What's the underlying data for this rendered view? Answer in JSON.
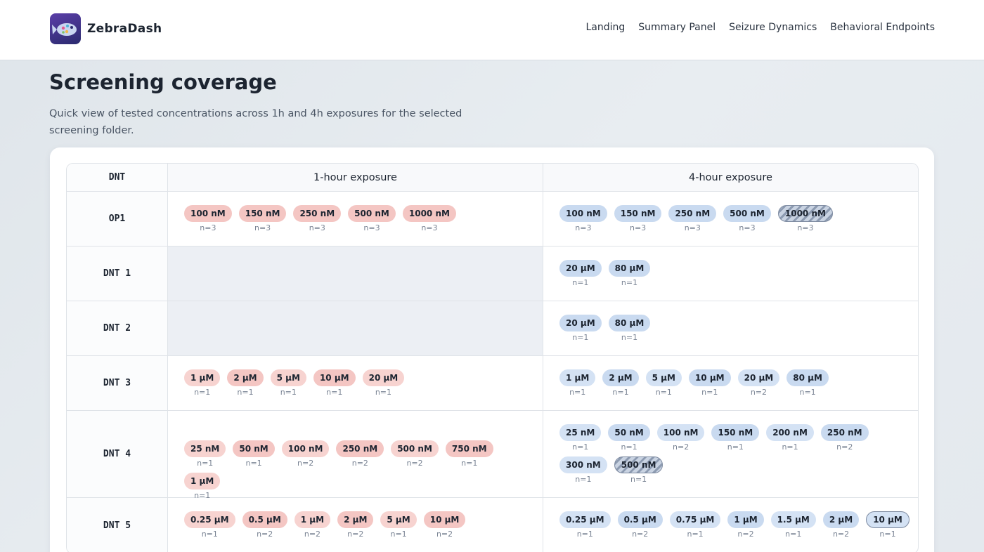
{
  "header": {
    "brand": "ZebraDash",
    "nav": [
      "Landing",
      "Summary Panel",
      "Seizure Dynamics",
      "Behavioral Endpoints"
    ]
  },
  "page": {
    "title": "Screening coverage",
    "subtitle": "Quick view of tested concentrations across 1h and 4h exposures for the selected screening folder."
  },
  "table": {
    "columns": [
      "DNT",
      "1-hour exposure",
      "4-hour exposure"
    ],
    "rows": [
      {
        "name": "OP1",
        "one": [
          {
            "dose": "100 nM",
            "n": "n=3"
          },
          {
            "dose": "150 nM",
            "n": "n=3"
          },
          {
            "dose": "250 nM",
            "n": "n=3"
          },
          {
            "dose": "500 nM",
            "n": "n=3"
          },
          {
            "dose": "1000 nM",
            "n": "n=3"
          }
        ],
        "four": [
          {
            "dose": "100 nM",
            "n": "n=3"
          },
          {
            "dose": "150 nM",
            "n": "n=3"
          },
          {
            "dose": "250 nM",
            "n": "n=3"
          },
          {
            "dose": "500 nM",
            "n": "n=3"
          },
          {
            "dose": "1000 nM",
            "n": "n=3",
            "flagged": true
          }
        ]
      },
      {
        "name": "DNT 1",
        "one": [],
        "four": [
          {
            "dose": "20 µM",
            "n": "n=1"
          },
          {
            "dose": "80 µM",
            "n": "n=1"
          }
        ]
      },
      {
        "name": "DNT 2",
        "one": [],
        "four": [
          {
            "dose": "20 µM",
            "n": "n=1"
          },
          {
            "dose": "80 µM",
            "n": "n=1"
          }
        ]
      },
      {
        "name": "DNT 3",
        "one": [
          {
            "dose": "1 µM",
            "n": "n=1"
          },
          {
            "dose": "2 µM",
            "n": "n=1"
          },
          {
            "dose": "5 µM",
            "n": "n=1"
          },
          {
            "dose": "10 µM",
            "n": "n=1"
          },
          {
            "dose": "20 µM",
            "n": "n=1"
          }
        ],
        "four": [
          {
            "dose": "1 µM",
            "n": "n=1"
          },
          {
            "dose": "2 µM",
            "n": "n=1"
          },
          {
            "dose": "5 µM",
            "n": "n=1"
          },
          {
            "dose": "10 µM",
            "n": "n=1"
          },
          {
            "dose": "20 µM",
            "n": "n=2"
          },
          {
            "dose": "80 µM",
            "n": "n=1"
          }
        ]
      },
      {
        "name": "DNT 4",
        "one": [
          {
            "dose": "25 nM",
            "n": "n=1"
          },
          {
            "dose": "50 nM",
            "n": "n=1"
          },
          {
            "dose": "100 nM",
            "n": "n=2"
          },
          {
            "dose": "250 nM",
            "n": "n=2"
          },
          {
            "dose": "500 nM",
            "n": "n=2"
          },
          {
            "dose": "750 nM",
            "n": "n=1"
          },
          {
            "dose": "1 µM",
            "n": "n=1"
          }
        ],
        "four": [
          {
            "dose": "25 nM",
            "n": "n=1"
          },
          {
            "dose": "50 nM",
            "n": "n=1"
          },
          {
            "dose": "100 nM",
            "n": "n=2"
          },
          {
            "dose": "150 nM",
            "n": "n=1"
          },
          {
            "dose": "200 nM",
            "n": "n=1"
          },
          {
            "dose": "250 nM",
            "n": "n=2"
          },
          {
            "dose": "300 nM",
            "n": "n=1"
          },
          {
            "dose": "500 nM",
            "n": "n=1",
            "flagged": true
          }
        ]
      },
      {
        "name": "DNT 5",
        "one": [
          {
            "dose": "0.25 µM",
            "n": "n=1"
          },
          {
            "dose": "0.5 µM",
            "n": "n=2"
          },
          {
            "dose": "1 µM",
            "n": "n=2"
          },
          {
            "dose": "2 µM",
            "n": "n=2"
          },
          {
            "dose": "5 µM",
            "n": "n=1"
          },
          {
            "dose": "10 µM",
            "n": "n=2"
          }
        ],
        "four": [
          {
            "dose": "0.25 µM",
            "n": "n=1"
          },
          {
            "dose": "0.5 µM",
            "n": "n=2"
          },
          {
            "dose": "0.75 µM",
            "n": "n=1"
          },
          {
            "dose": "1 µM",
            "n": "n=2"
          },
          {
            "dose": "1.5 µM",
            "n": "n=1"
          },
          {
            "dose": "2 µM",
            "n": "n=2"
          },
          {
            "dose": "10 µM",
            "n": "n=1",
            "flagged": true
          }
        ]
      }
    ]
  },
  "colors": {
    "one_hour_chip": "#f4c6c3",
    "four_hour_chip": "#c9daf0",
    "flagged_hatch": "#8d9bb1"
  }
}
